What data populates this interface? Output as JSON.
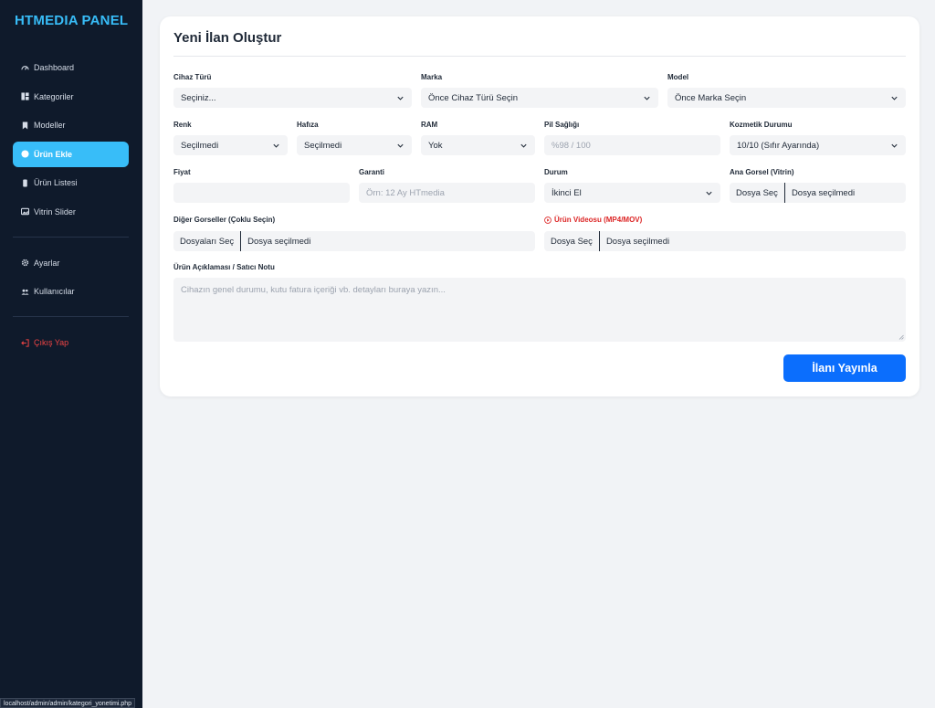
{
  "brand": "HTMEDIA PANEL",
  "sidebar": {
    "items": [
      {
        "label": "Dashboard",
        "icon": "gauge-icon",
        "active": false
      },
      {
        "label": "Kategoriler",
        "icon": "grid-icon",
        "active": false
      },
      {
        "label": "Modeller",
        "icon": "bookmark-icon",
        "active": false
      },
      {
        "label": "Ürün Ekle",
        "icon": "plus-circle-icon",
        "active": true
      },
      {
        "label": "Ürün Listesi",
        "icon": "phone-icon",
        "active": false
      },
      {
        "label": "Vitrin Slider",
        "icon": "image-icon",
        "active": false
      }
    ],
    "settings": [
      {
        "label": "Ayarlar",
        "icon": "gear-icon"
      },
      {
        "label": "Kullanıcılar",
        "icon": "users-icon"
      }
    ],
    "logout": {
      "label": "Çıkış Yap",
      "icon": "logout-icon"
    }
  },
  "statusbar": "localhost/admin/admin/kategori_yonetimi.php",
  "form": {
    "title": "Yeni İlan Oluştur",
    "cihaz_turu": {
      "label": "Cihaz Türü",
      "value": "Seçiniz..."
    },
    "marka": {
      "label": "Marka",
      "value": "Önce Cihaz Türü Seçin"
    },
    "model": {
      "label": "Model",
      "value": "Önce Marka Seçin"
    },
    "renk": {
      "label": "Renk",
      "value": "Seçilmedi"
    },
    "hafiza": {
      "label": "Hafıza",
      "value": "Seçilmedi"
    },
    "ram": {
      "label": "RAM",
      "value": "Yok"
    },
    "pil": {
      "label": "Pil Sağlığı",
      "placeholder": "%98 / 100"
    },
    "kozmetik": {
      "label": "Kozmetik Durumu",
      "value": "10/10 (Sıfır Ayarında)"
    },
    "fiyat": {
      "label": "Fiyat",
      "value": ""
    },
    "garanti": {
      "label": "Garanti",
      "placeholder": "Örn: 12 Ay HTmedia"
    },
    "durum": {
      "label": "Durum",
      "value": "İkinci El"
    },
    "ana_gorsel": {
      "label": "Ana Gorsel (Vitrin)",
      "button": "Dosya Seç",
      "file": "Dosya seçilmedi"
    },
    "diger_gorseller": {
      "label": "Diğer Gorseller (Çoklu Seçin)",
      "button": "Dosyaları Seç",
      "file": "Dosya seçilmedi"
    },
    "video": {
      "label": "Ürün Videosu (MP4/MOV)",
      "button": "Dosya Seç",
      "file": "Dosya seçilmedi"
    },
    "aciklama": {
      "label": "Ürün Açıklaması / Satıcı Notu",
      "placeholder": "Cihazın genel durumu, kutu fatura içeriği vb. detayları buraya yazın..."
    },
    "submit": "İlanı Yayınla"
  },
  "colors": {
    "sidebar_bg": "#0f1a2b",
    "accent": "#38bdf8",
    "primary_button": "#0b6efd",
    "danger": "#dc2626"
  }
}
